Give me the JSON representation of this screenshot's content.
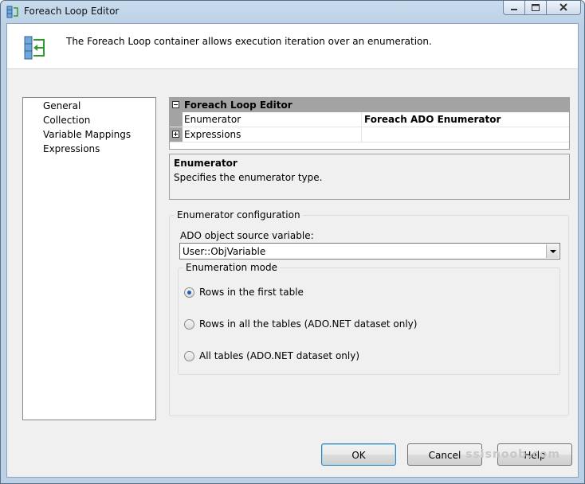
{
  "window": {
    "title": "Foreach Loop Editor"
  },
  "header": {
    "description": "The Foreach Loop container allows execution iteration over an enumeration."
  },
  "nav": {
    "items": [
      "General",
      "Collection",
      "Variable Mappings",
      "Expressions"
    ]
  },
  "grid": {
    "category": "Foreach Loop Editor",
    "rows": [
      {
        "name": "Enumerator",
        "value": "Foreach ADO Enumerator"
      },
      {
        "name": "Expressions",
        "value": ""
      }
    ]
  },
  "description_panel": {
    "title": "Enumerator",
    "text": "Specifies the enumerator type."
  },
  "config": {
    "group_label": "Enumerator configuration",
    "source_label": "ADO object source variable:",
    "source_value": "User::ObjVariable",
    "mode_label": "Enumeration mode",
    "options": [
      "Rows in the first table",
      "Rows in all the tables (ADO.NET dataset only)",
      "All tables (ADO.NET dataset only)"
    ],
    "selected_option": 0
  },
  "buttons": {
    "ok": "OK",
    "cancel": "Cancel",
    "help": "Help"
  },
  "watermark": "ssisnoob.com",
  "colors": {
    "accent": "#3c7fb1",
    "category_bar": "#a3a3a3",
    "radio_dot": "#1f5fb0"
  }
}
